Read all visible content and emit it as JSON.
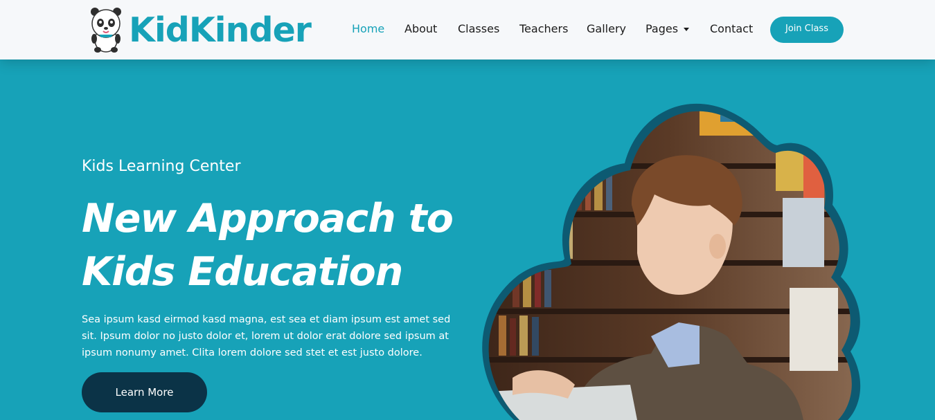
{
  "brand": {
    "name": "KidKinder",
    "logo_icon": "panda-logo-icon"
  },
  "nav": {
    "items": [
      {
        "label": "Home",
        "active": true
      },
      {
        "label": "About",
        "active": false
      },
      {
        "label": "Classes",
        "active": false
      },
      {
        "label": "Teachers",
        "active": false
      },
      {
        "label": "Gallery",
        "active": false
      },
      {
        "label": "Pages",
        "active": false,
        "dropdown": true
      },
      {
        "label": "Contact",
        "active": false
      }
    ],
    "cta_label": "Join Class"
  },
  "hero": {
    "kicker": "Kids Learning Center",
    "headline_line1": "New Approach to",
    "headline_line2": "Kids Education",
    "description": "Sea ipsum kasd eirmod kasd magna, est sea et diam ipsum est amet sed sit. Ipsum dolor no justo dolor et, lorem ut dolor erat dolore sed ipsum at ipsum nonumy amet. Clita lorem dolore sed stet et est justo dolore.",
    "button_label": "Learn More",
    "image_alt": "Boy reading a book in a library"
  },
  "colors": {
    "primary": "#17a2b8",
    "dark": "#0b3347",
    "nav_bg": "#f6f8fa",
    "text_dark": "#1b1b1b",
    "white": "#ffffff"
  }
}
